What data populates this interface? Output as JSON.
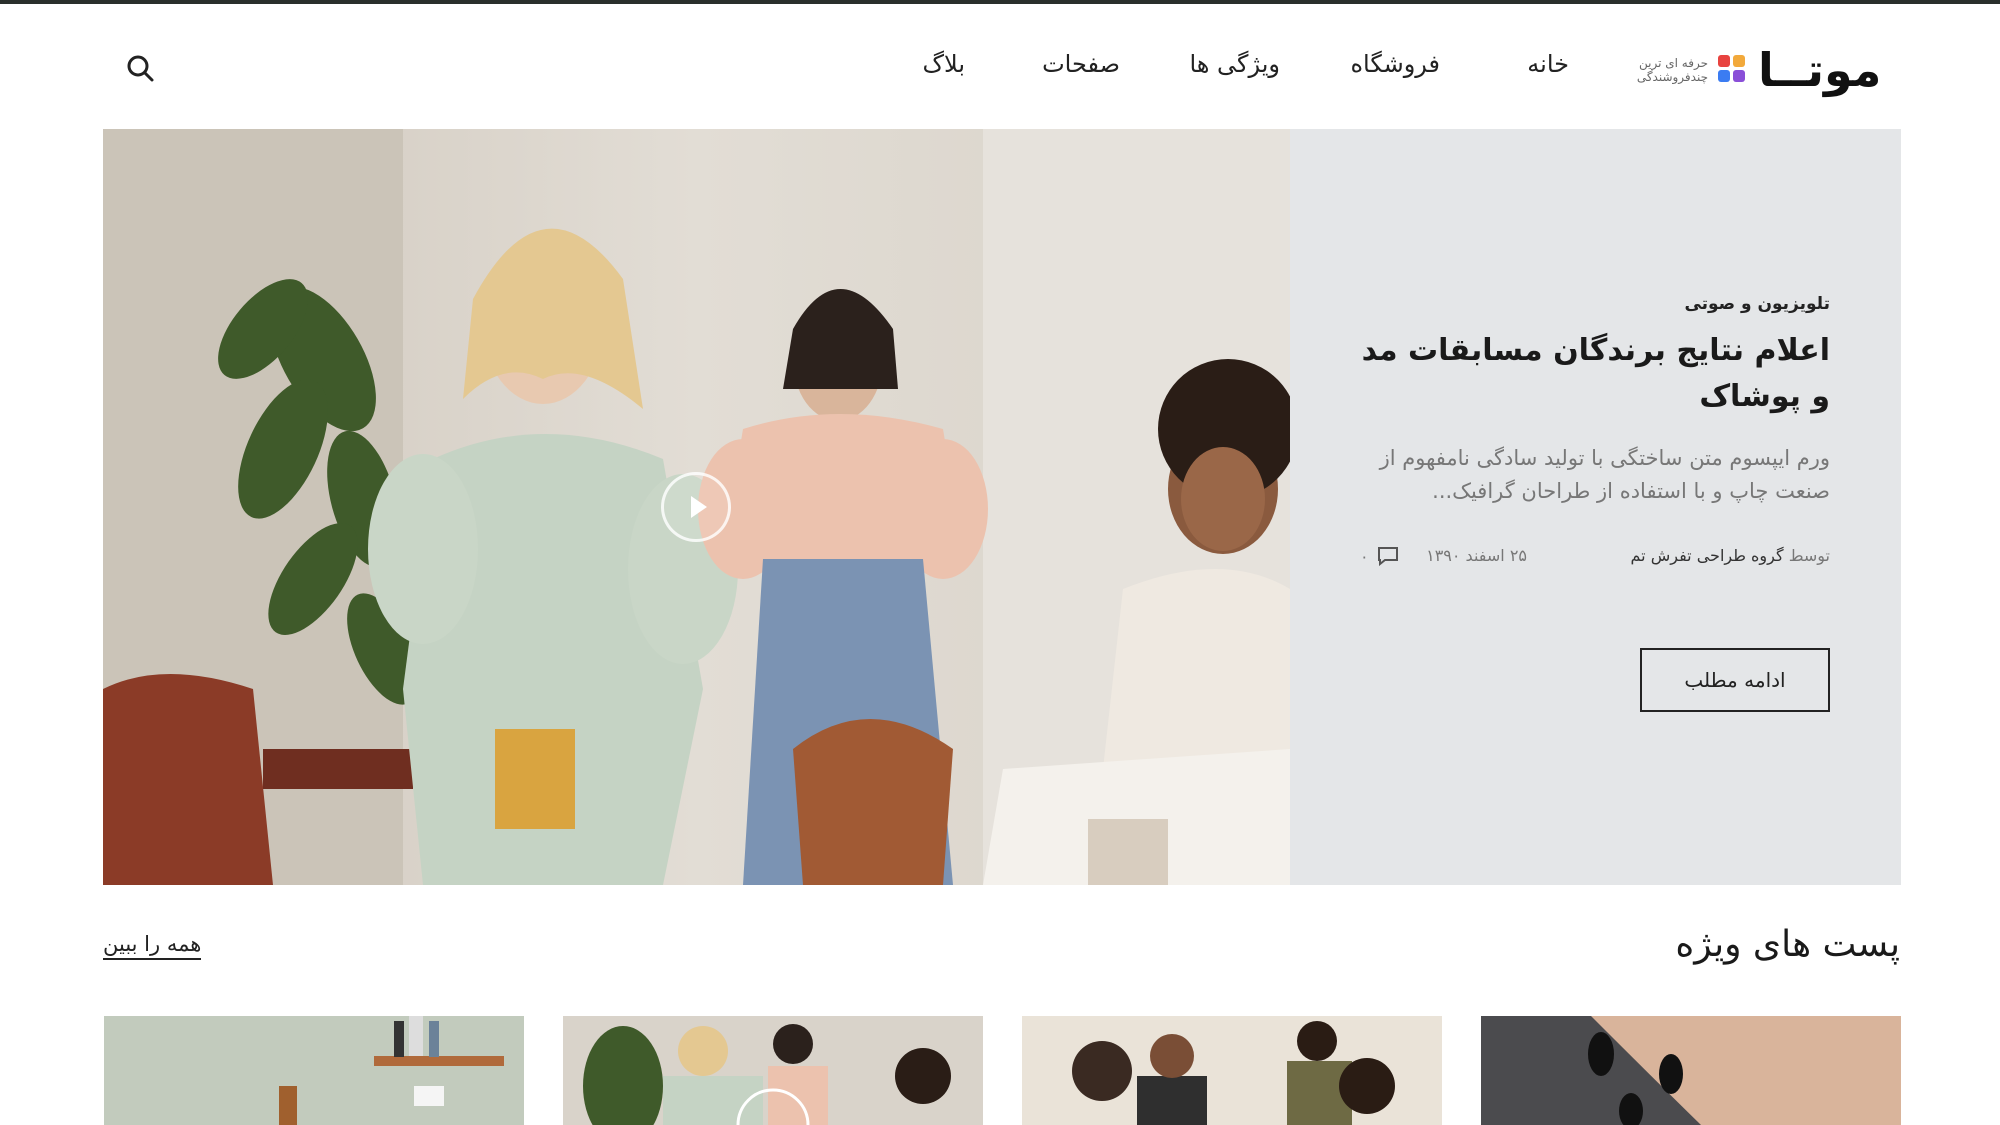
{
  "brand": {
    "name": "موتــا",
    "tagline_line1": "حرفه ای ترین",
    "tagline_line2": "چندفروشندگی",
    "colors": [
      "#e8433f",
      "#f2a93b",
      "#3b7cf2",
      "#8a4fd8"
    ]
  },
  "nav": {
    "items": [
      "خانه",
      "فروشگاه",
      "ویژگی ها",
      "صفحات",
      "بلاگ"
    ],
    "search_icon": "search-icon"
  },
  "hero": {
    "category": "تلویزیون و صوتی",
    "title": "اعلام نتایج برندگان مسابقات مد و پوشاک",
    "excerpt": "ورم ایپسوم متن ساختگی با تولید سادگی نامفهوم از صنعت چاپ و با استفاده از طراحان گرافیک...",
    "by_prefix": "توسط",
    "author": "گروه طراحی تفرش تم",
    "date": "۲۵ اسفند ۱۳۹۰",
    "comments": "۰",
    "read_more": "ادامه مطلب",
    "panel_color": "#e4e6e8"
  },
  "featured": {
    "title": "پست های ویژه",
    "see_all": "همه را ببین",
    "card_count_visible": 4
  }
}
